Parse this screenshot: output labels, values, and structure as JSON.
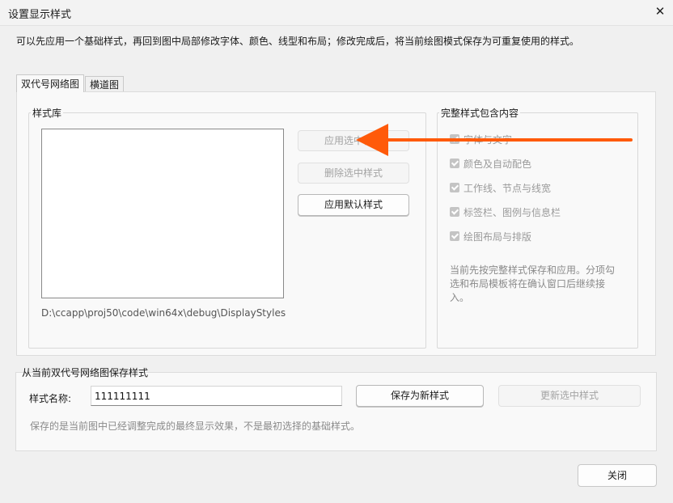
{
  "window": {
    "title": "设置显示样式",
    "close_glyph": "✕"
  },
  "hint": "可以先应用一个基础样式，再回到图中局部修改字体、颜色、线型和布局；修改完成后，将当前绘图模式保存为可重复使用的样式。",
  "tabs": [
    {
      "label": "双代号网络图",
      "active": true
    },
    {
      "label": "横道图",
      "active": false
    }
  ],
  "library": {
    "legend": "样式库",
    "items": [],
    "path": "D:\\ccapp\\proj50\\code\\win64x\\debug\\DisplayStyles",
    "buttons": {
      "apply_selected": "应用选中样式",
      "delete_selected": "删除选中样式",
      "apply_default": "应用默认样式"
    }
  },
  "contents": {
    "legend": "完整样式包含内容",
    "options": [
      {
        "label": "字体与文字",
        "checked": true,
        "enabled": false
      },
      {
        "label": "颜色及自动配色",
        "checked": true,
        "enabled": false
      },
      {
        "label": "工作线、节点与线宽",
        "checked": true,
        "enabled": false
      },
      {
        "label": "标签栏、图例与信息栏",
        "checked": true,
        "enabled": false
      },
      {
        "label": "绘图布局与排版",
        "checked": true,
        "enabled": false
      }
    ],
    "note": "当前先按完整样式保存和应用。分项勾选和布局模板将在确认窗口后继续接入。"
  },
  "save": {
    "legend": "从当前双代号网络图保存样式",
    "name_label": "样式名称:",
    "name_value": "111111111",
    "save_new": "保存为新样式",
    "update_selected": "更新选中样式",
    "note": "保存的是当前图中已经调整完成的最终显示效果，不是最初选择的基础样式。"
  },
  "footer": {
    "close": "关闭"
  },
  "annotation": {
    "color": "#ff5a0a",
    "icon": "arrow-left-icon"
  }
}
